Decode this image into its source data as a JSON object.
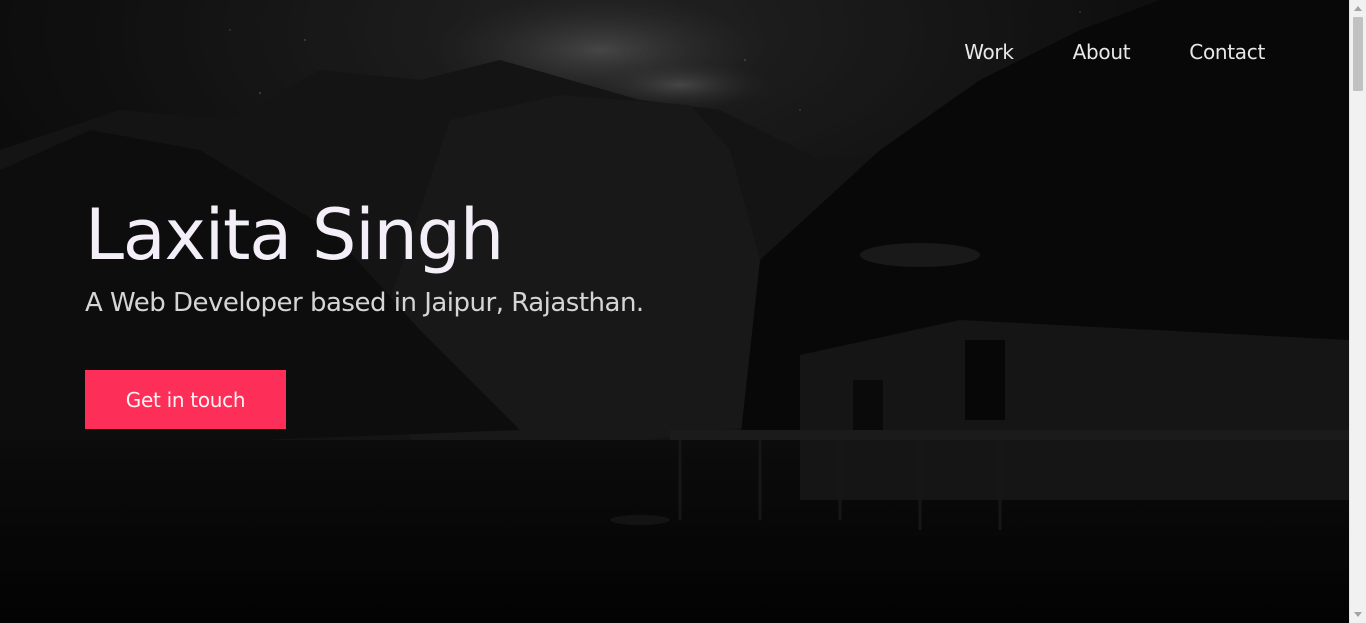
{
  "nav": {
    "items": [
      {
        "label": "Work"
      },
      {
        "label": "About"
      },
      {
        "label": "Contact"
      }
    ]
  },
  "hero": {
    "title": "Laxita Singh",
    "subtitle": "A Web Developer based in Jaipur, Rajasthan.",
    "cta_label": "Get in touch",
    "background_image": "dark-mountain-lake-cabin-night"
  },
  "colors": {
    "accent": "#fd2f58",
    "background": "#060606",
    "text_primary": "#f3eef8",
    "text_secondary": "#d5d5d5"
  },
  "icons": {
    "scroll_up": "chevron-up-icon",
    "scroll_down": "chevron-down-icon"
  }
}
